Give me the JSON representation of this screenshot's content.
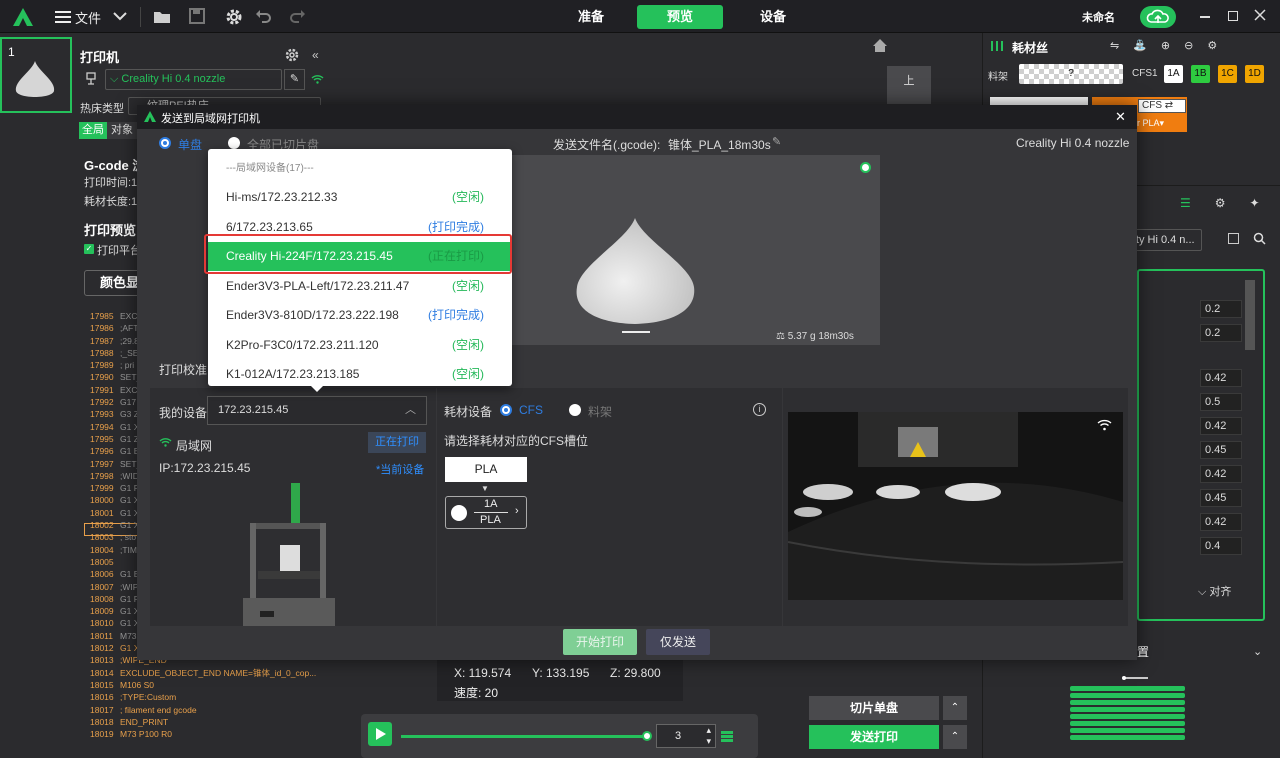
{
  "topbar": {
    "file_label": "文件",
    "tabs": [
      "准备",
      "预览",
      "设备"
    ],
    "active_tab": "预览",
    "project_name": "未命名"
  },
  "plate": {
    "number": "1"
  },
  "left": {
    "printer_title": "打印机",
    "printer_name": "Creality Hi 0.4 nozzle",
    "hotbed_label": "热床类型",
    "hotbed_value": "纹理PEI热床",
    "tab_global": "全局",
    "tab_object": "对象",
    "gcode_title": "G-code 浏",
    "print_time": "打印时间:1",
    "filament_length": "耗材长度:1",
    "preview_title": "打印预览",
    "plate_checkbox": "打印平台",
    "color_btn": "颜色显",
    "gcode_lines": [
      [
        "17985",
        "EXCL"
      ],
      [
        "17986",
        ";AFT"
      ],
      [
        "17987",
        ";29.8"
      ],
      [
        "17988",
        ";_SE"
      ],
      [
        "17989",
        "; pri"
      ],
      [
        "17990",
        "SET_"
      ],
      [
        "17991",
        "EXC"
      ],
      [
        "17992",
        "G17"
      ],
      [
        "17993",
        "G3 Z"
      ],
      [
        "17994",
        "G1 X"
      ],
      [
        "17995",
        "G1 Z"
      ],
      [
        "17996",
        "G1 E"
      ],
      [
        "17997",
        "SET_"
      ],
      [
        "17998",
        ";WID"
      ],
      [
        "17999",
        "G1 F"
      ],
      [
        "18000",
        "G1 X"
      ],
      [
        "18001",
        "G1 X"
      ],
      [
        "18002",
        "G1 X"
      ],
      [
        "18003",
        "; sto"
      ],
      [
        "18004",
        ";TIM"
      ],
      [
        "18005",
        ""
      ],
      [
        "18006",
        "G1 E"
      ],
      [
        "18007",
        ";WIP"
      ],
      [
        "18008",
        "G1 F"
      ],
      [
        "18009",
        "G1 X"
      ],
      [
        "18010",
        "G1 X"
      ],
      [
        "18011",
        "M73"
      ],
      [
        "18012",
        "G1 X117.373 Y133.232"
      ],
      [
        "18013",
        ";WIPE_END"
      ],
      [
        "18014",
        "EXCLUDE_OBJECT_END NAME=锥体_id_0_cop..."
      ],
      [
        "18015",
        "M106 S0"
      ],
      [
        "18016",
        ";TYPE:Custom"
      ],
      [
        "18017",
        "; filament end gcode"
      ],
      [
        "18018",
        "END_PRINT"
      ],
      [
        "18019",
        "M73 P100 R0"
      ]
    ]
  },
  "right": {
    "filament_title": "耗材丝",
    "rack_label": "料架",
    "cfs_label": "CFS1",
    "slots": [
      "1A",
      "1B",
      "1C",
      "1D"
    ],
    "slot_colors": [
      "#ffffff",
      "#2ecc40",
      "#f0a500",
      "#f0a500"
    ],
    "cfs_btn": "CFS",
    "pla_tag": "r PLA",
    "preset_name": "lity Hi 0.4 n...",
    "values": [
      "0.2",
      "0.2",
      "0.42",
      "0.5",
      "0.42",
      "0.45",
      "0.42",
      "0.45",
      "0.42",
      "0.4"
    ],
    "align_label": "对齐",
    "section2": "置"
  },
  "viewport": {
    "coords": {
      "x": "X: 119.574",
      "y": "Y: 133.195",
      "z": "Z: 29.800",
      "speed": "速度: 20"
    },
    "view_btn": "上",
    "layer_value": "3",
    "slice_plate": "切片单盘",
    "send_print": "发送打印"
  },
  "dialog": {
    "title": "发送到局域网打印机",
    "mode_single": "单盘",
    "mode_all": "全部已切片盘",
    "filename_label": "发送文件名(.gcode):",
    "filename": "锥体_PLA_18m30s",
    "nozzle": "Creality Hi 0.4 nozzle",
    "stats": "5.37 g  18m30s",
    "calib_label": "打印校准",
    "my_device_label": "我的设备",
    "device_value": "172.23.215.45",
    "network": "局域网",
    "status_badge": "正在打印",
    "ip": "IP:172.23.215.45",
    "current_device": "*当前设备",
    "filament_device": "耗材设备",
    "opt_cfs": "CFS",
    "opt_rack": "料架",
    "select_hint": "请选择耗材对应的CFS槽位",
    "material": "PLA",
    "slot_id": "1A",
    "slot_material": "PLA",
    "start_btn": "开始打印",
    "send_only_btn": "仅发送"
  },
  "dropdown": {
    "header": "---局域网设备(17)---",
    "items": [
      {
        "name": "Hi-ms/172.23.212.33",
        "status": "(空闲)",
        "color": "#25b85a"
      },
      {
        "name": "6/172.23.213.65",
        "status": "(打印完成)",
        "color": "#2f7de1"
      },
      {
        "name": "Creality Hi-224F/172.23.215.45",
        "status": "(正在打印)",
        "color": "#25b85a"
      },
      {
        "name": "Ender3V3-PLA-Left/172.23.211.47",
        "status": "(空闲)",
        "color": "#25b85a"
      },
      {
        "name": "Ender3V3-810D/172.23.222.198",
        "status": "(打印完成)",
        "color": "#2f7de1"
      },
      {
        "name": "K2Pro-F3C0/172.23.211.120",
        "status": "(空闲)",
        "color": "#25b85a"
      },
      {
        "name": "K1-012A/172.23.213.185",
        "status": "(空闲)",
        "color": "#25b85a"
      }
    ]
  }
}
